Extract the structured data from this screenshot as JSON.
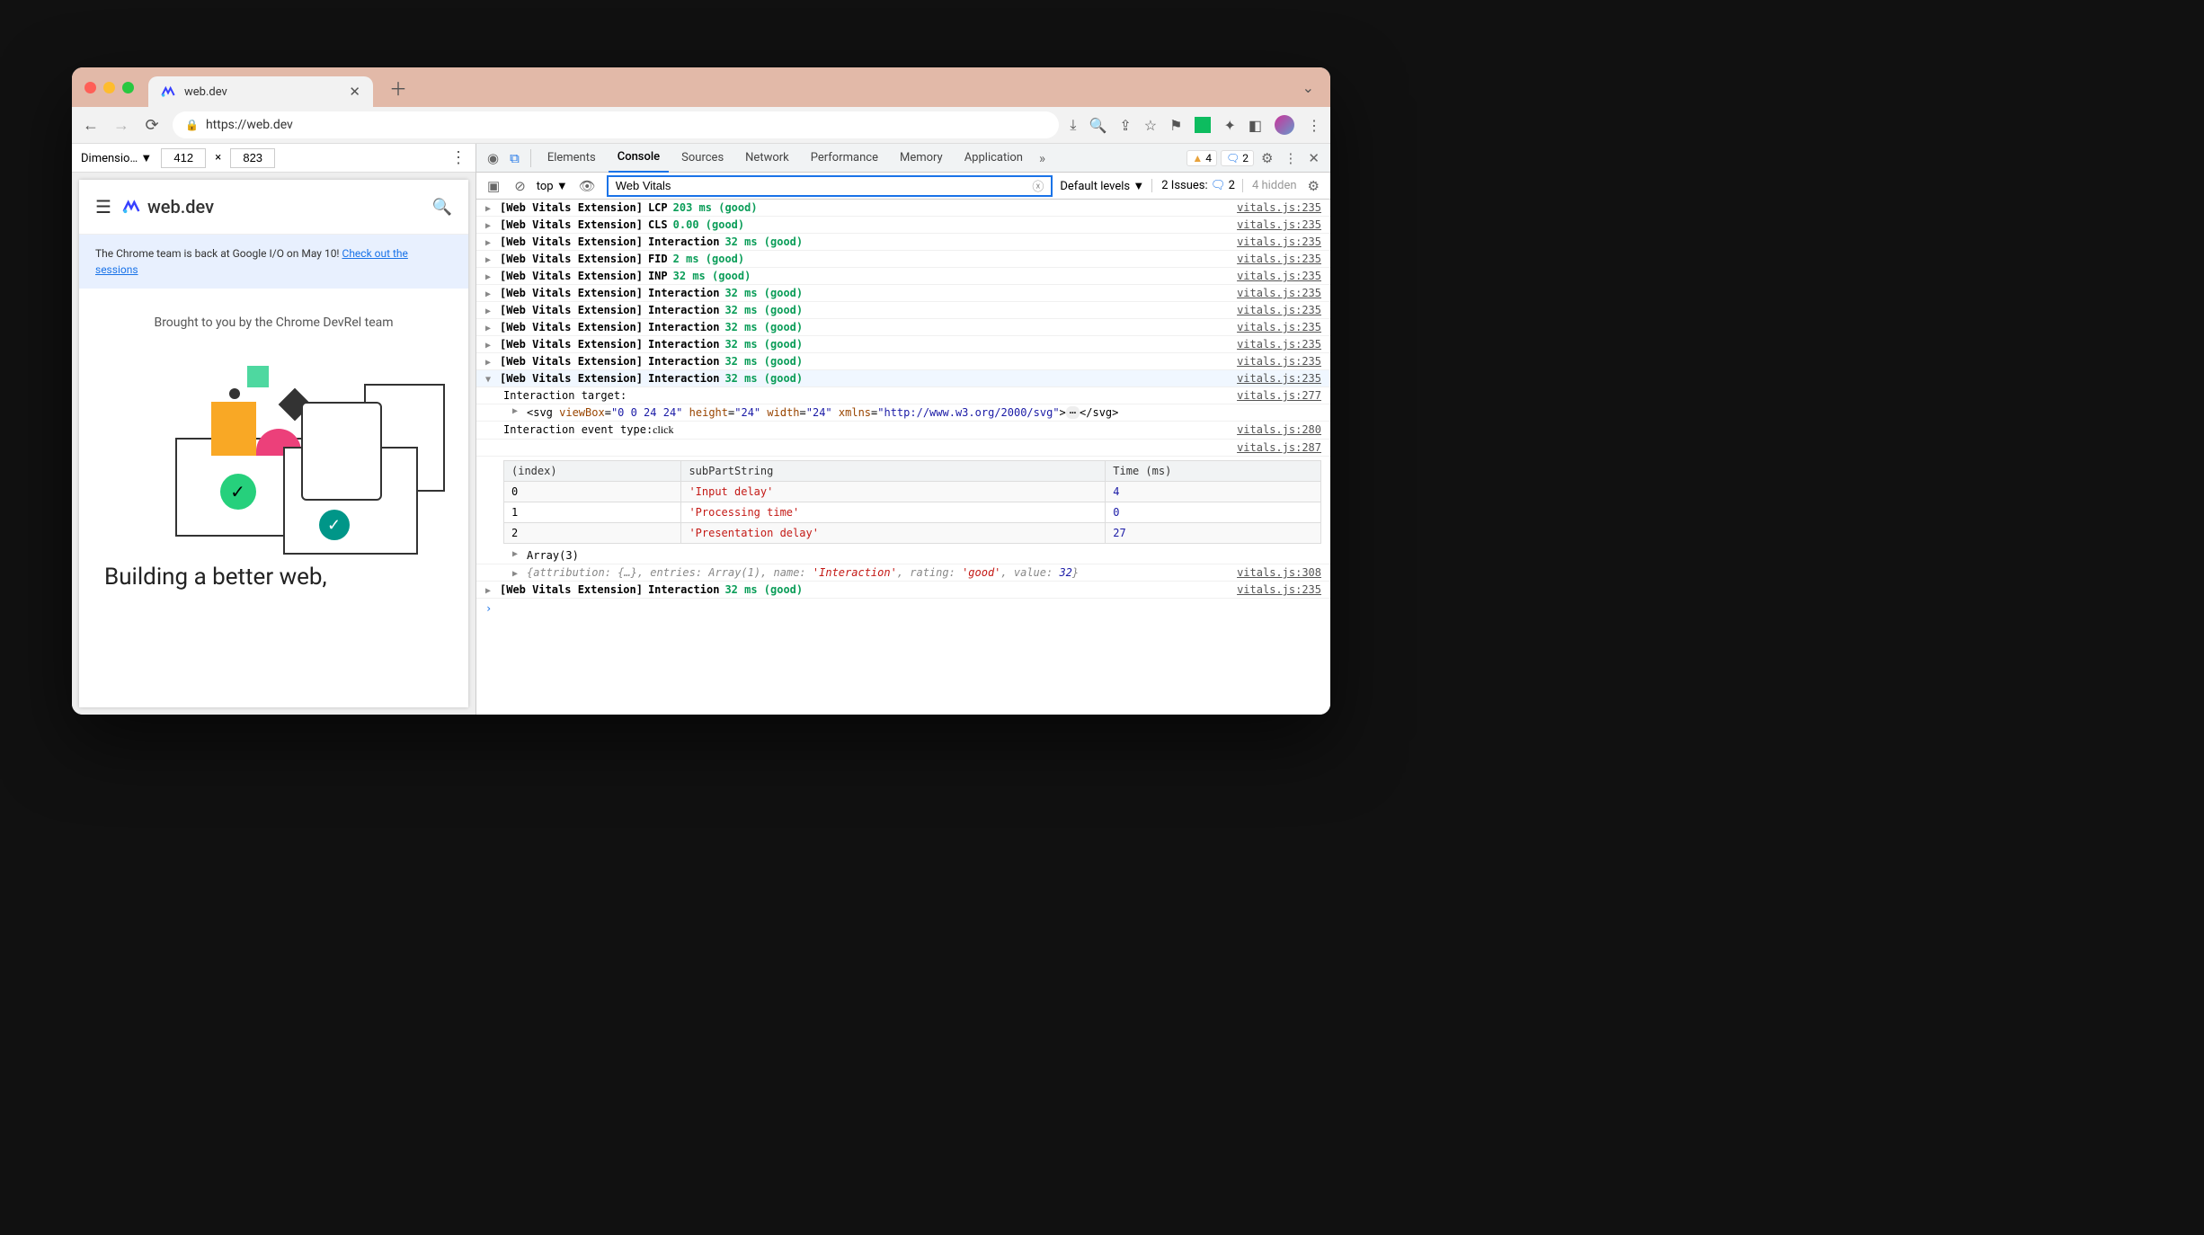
{
  "tab": {
    "title": "web.dev"
  },
  "url": "https://web.dev",
  "device_toolbar": {
    "label": "Dimensio…",
    "width": "412",
    "times": "×",
    "height": "823"
  },
  "devtools_tabs": [
    "Elements",
    "Console",
    "Sources",
    "Network",
    "Performance",
    "Memory",
    "Application"
  ],
  "warnings_count": "4",
  "messages_count": "2",
  "console_toolbar": {
    "context": "top",
    "filter_value": "Web Vitals",
    "levels": "Default levels",
    "issues_label": "2 Issues:",
    "issues_count": "2",
    "hidden": "4 hidden"
  },
  "console_logs": [
    {
      "label": "[Web Vitals Extension]",
      "metric": "LCP",
      "value": "203 ms (good)",
      "src": "vitals.js:235"
    },
    {
      "label": "[Web Vitals Extension]",
      "metric": "CLS",
      "value": "0.00 (good)",
      "src": "vitals.js:235"
    },
    {
      "label": "[Web Vitals Extension]",
      "metric": "Interaction",
      "value": "32 ms (good)",
      "src": "vitals.js:235"
    },
    {
      "label": "[Web Vitals Extension]",
      "metric": "FID",
      "value": "2 ms (good)",
      "src": "vitals.js:235"
    },
    {
      "label": "[Web Vitals Extension]",
      "metric": "INP",
      "value": "32 ms (good)",
      "src": "vitals.js:235"
    },
    {
      "label": "[Web Vitals Extension]",
      "metric": "Interaction",
      "value": "32 ms (good)",
      "src": "vitals.js:235"
    },
    {
      "label": "[Web Vitals Extension]",
      "metric": "Interaction",
      "value": "32 ms (good)",
      "src": "vitals.js:235"
    },
    {
      "label": "[Web Vitals Extension]",
      "metric": "Interaction",
      "value": "32 ms (good)",
      "src": "vitals.js:235"
    },
    {
      "label": "[Web Vitals Extension]",
      "metric": "Interaction",
      "value": "32 ms (good)",
      "src": "vitals.js:235"
    },
    {
      "label": "[Web Vitals Extension]",
      "metric": "Interaction",
      "value": "32 ms (good)",
      "src": "vitals.js:235"
    }
  ],
  "expanded_log": {
    "label": "[Web Vitals Extension]",
    "metric": "Interaction",
    "value": "32 ms (good)",
    "src": "vitals.js:235",
    "target_label": "Interaction target:",
    "target_src": "vitals.js:277",
    "svg_viewbox": "0 0 24 24",
    "svg_height": "24",
    "svg_width": "24",
    "svg_xmlns": "http://www.w3.org/2000/svg",
    "event_label": "Interaction event type:",
    "event_value": "click",
    "event_src": "vitals.js:280",
    "table_src": "vitals.js:287",
    "array_label": "Array(3)",
    "attr_src": "vitals.js:308",
    "attribution_text": "{attribution: {…}, entries: Array(1), name: 'Interaction', rating: 'good', value: 32}"
  },
  "interaction_table": {
    "headers": [
      "(index)",
      "subPartString",
      "Time (ms)"
    ],
    "rows": [
      {
        "index": "0",
        "subPartString": "'Input delay'",
        "time": "4"
      },
      {
        "index": "1",
        "subPartString": "'Processing time'",
        "time": "0"
      },
      {
        "index": "2",
        "subPartString": "'Presentation delay'",
        "time": "27"
      }
    ]
  },
  "final_log": {
    "label": "[Web Vitals Extension]",
    "metric": "Interaction",
    "value": "32 ms (good)",
    "src": "vitals.js:235"
  },
  "page": {
    "brand": "web.dev",
    "banner_text": "The Chrome team is back at Google I/O on May 10! ",
    "banner_link": "Check out the sessions",
    "subtitle": "Brought to you by the Chrome DevRel team",
    "headline": "Building a better web,"
  }
}
